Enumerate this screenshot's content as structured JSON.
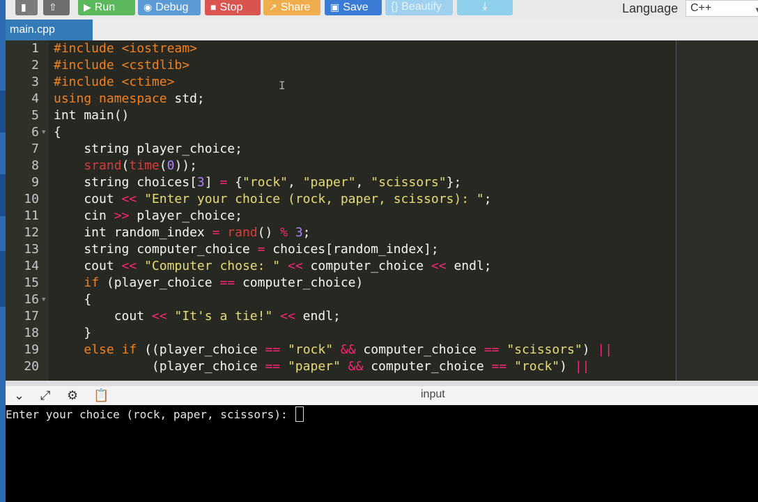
{
  "toolbar": {
    "run_label": "Run",
    "debug_label": "Debug",
    "stop_label": "Stop",
    "share_label": "Share",
    "save_label": "Save",
    "beautify_label": "{} Beautify",
    "language_label": "Language",
    "language_value": "C++"
  },
  "tabs": [
    {
      "label": "main.cpp"
    }
  ],
  "io": {
    "title": "input",
    "console_text": "Enter your choice (rock, paper, scissors): "
  },
  "colors": {
    "run": "#5cb85c",
    "debug": "#5b9bd5",
    "stop": "#d9534f",
    "share": "#f0ad4e",
    "save": "#3a7bd5",
    "tab": "#337ab7",
    "editor_bg": "#272822"
  },
  "icons": [
    "file-icon",
    "upload-icon",
    "play-icon",
    "debug-icon",
    "stop-icon",
    "share-icon",
    "save-icon",
    "download-icon",
    "chevron-down-icon",
    "expand-icon",
    "gear-icon",
    "clipboard-icon"
  ],
  "editor": {
    "lines": [
      {
        "n": "1",
        "t": "#include <iostream>"
      },
      {
        "n": "2",
        "t": "#include <cstdlib>"
      },
      {
        "n": "3",
        "t": "#include <ctime>"
      },
      {
        "n": "4",
        "t": "using namespace std;"
      },
      {
        "n": "5",
        "t": "int main()"
      },
      {
        "n": "6",
        "t": "{"
      },
      {
        "n": "7",
        "t": "    string player_choice;"
      },
      {
        "n": "8",
        "t": "    srand(time(0));"
      },
      {
        "n": "9",
        "t": "    string choices[3] = {\"rock\", \"paper\", \"scissors\"};"
      },
      {
        "n": "10",
        "t": "    cout << \"Enter your choice (rock, paper, scissors): \";"
      },
      {
        "n": "11",
        "t": "    cin >> player_choice;"
      },
      {
        "n": "12",
        "t": "    int random_index = rand() % 3;"
      },
      {
        "n": "13",
        "t": "    string computer_choice = choices[random_index];"
      },
      {
        "n": "14",
        "t": "    cout << \"Computer chose: \" << computer_choice << endl;"
      },
      {
        "n": "15",
        "t": "    if (player_choice == computer_choice)"
      },
      {
        "n": "16",
        "t": "    {"
      },
      {
        "n": "17",
        "t": "        cout << \"It's a tie!\" << endl;"
      },
      {
        "n": "18",
        "t": "    }"
      },
      {
        "n": "19",
        "t": "    else if ((player_choice == \"rock\" && computer_choice == \"scissors\") ||"
      },
      {
        "n": "20",
        "t": "             (player_choice == \"paper\" && computer_choice == \"rock\") ||"
      }
    ]
  }
}
